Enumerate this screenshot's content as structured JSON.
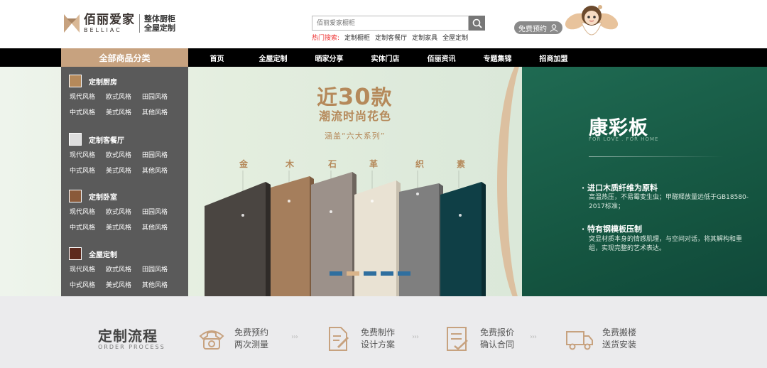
{
  "header": {
    "logo_cn": "佰丽爱家",
    "logo_en": "BELLIAC",
    "tagline_1": "整体厨柜",
    "tagline_2": "全屋定制",
    "search_placeholder": "佰丽爱家橱柜",
    "hot_label": "热门搜索:",
    "hot_links": [
      "定制橱柜",
      "定制客餐厅",
      "定制家具",
      "全屋定制"
    ],
    "reserve_label": "免费预约"
  },
  "nav": {
    "category_label": "全部商品分类",
    "items": [
      "首页",
      "全屋定制",
      "晒家分享",
      "实体门店",
      "佰丽资讯",
      "专题集锦",
      "招商加盟"
    ]
  },
  "sidebar": {
    "categories": [
      {
        "title": "定制厨房",
        "row1": [
          "现代风格",
          "欧式风格",
          "田园风格"
        ],
        "row2": [
          "中式风格",
          "美式风格",
          "其他风格"
        ]
      },
      {
        "title": "定制客餐厅",
        "row1": [
          "现代风格",
          "欧式风格",
          "田园风格"
        ],
        "row2": [
          "中式风格",
          "美式风格",
          "其他风格"
        ]
      },
      {
        "title": "定制卧室",
        "row1": [
          "现代风格",
          "欧式风格",
          "田园风格"
        ],
        "row2": [
          "中式风格",
          "美式风格",
          "其他风格"
        ]
      },
      {
        "title": "全屋定制",
        "row1": [
          "现代风格",
          "欧式风格",
          "田园风格"
        ],
        "row2": [
          "中式风格",
          "美式风格",
          "其他风格"
        ]
      }
    ]
  },
  "banner": {
    "headline_pre": "近",
    "headline_num": "30",
    "headline_post": "款",
    "subheadline": "潮流时尚花色",
    "series": "涵盖“六大系列”",
    "materials": [
      "金",
      "木",
      "石",
      "革",
      "织",
      "素"
    ],
    "brand_title": "康彩板",
    "brand_sub": "FOR LOVE . FOR HOME",
    "feature1_title": "进口木质纤维为原料",
    "feature1_desc": "高温热压，不易霉变生虫；甲醛释放量远低于GB18580-2017标准；",
    "feature2_title": "特有钢模板压制",
    "feature2_desc": "突显材质本身的情感肌理，与空间对话，将其解构和重组，实现完整的艺术表达。",
    "slide_count": 5,
    "active_slide": 2
  },
  "process": {
    "title": "定制流程",
    "subtitle": "ORDER PROCESS",
    "steps": [
      {
        "line1": "免费预约",
        "line2": "两次测量",
        "icon": "phone-icon"
      },
      {
        "line1": "免费制作",
        "line2": "设计方案",
        "icon": "design-icon"
      },
      {
        "line1": "免费报价",
        "line2": "确认合同",
        "icon": "contract-icon"
      },
      {
        "line1": "免费搬楼",
        "line2": "送货安装",
        "icon": "truck-icon"
      }
    ],
    "arrow": "›››"
  },
  "colors": {
    "accent_gold": "#c7a27f",
    "nav_bg": "#000000",
    "sidebar_bg": "#5a5a5a",
    "panel_green": "#1f6a52",
    "hot_red": "#e33333"
  }
}
